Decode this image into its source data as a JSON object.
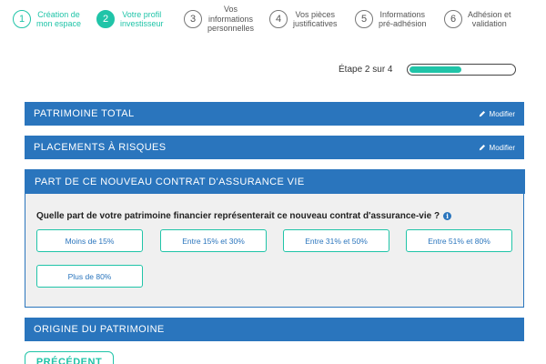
{
  "stepper": {
    "steps": [
      {
        "number": "1",
        "label": "Création de\nmon espace",
        "state": "done"
      },
      {
        "number": "2",
        "label": "Votre profil\ninvestisseur",
        "state": "active"
      },
      {
        "number": "3",
        "label": "Vos\ninformations\npersonnelles",
        "state": "todo"
      },
      {
        "number": "4",
        "label": "Vos pièces\njustificatives",
        "state": "todo"
      },
      {
        "number": "5",
        "label": "Informations\npré-adhésion",
        "state": "todo"
      },
      {
        "number": "6",
        "label": "Adhésion et\nvalidation",
        "state": "todo"
      }
    ]
  },
  "progress": {
    "text": "Étape 2 sur 4",
    "fraction": 0.5
  },
  "sections": {
    "patrimoine_total": {
      "title": "PATRIMOINE TOTAL",
      "modify_label": "Modifier"
    },
    "placements_risques": {
      "title": "PLACEMENTS À RISQUES",
      "modify_label": "Modifier"
    },
    "part_contrat": {
      "title": "PART DE CE NOUVEAU CONTRAT D'ASSURANCE VIE",
      "question": "Quelle part de votre patrimoine financier représenterait ce nouveau contrat d'assurance-vie ?",
      "options": [
        "Moins de 15%",
        "Entre 15% et 30%",
        "Entre 31% et 50%",
        "Entre 51% et 80%",
        "Plus de 80%"
      ]
    },
    "origine": {
      "title": "ORIGINE DU PATRIMOINE"
    }
  },
  "buttons": {
    "previous_label": "PRÉCÉDENT"
  },
  "colors": {
    "accent": "#20c4a8",
    "section_blue": "#2a75bd",
    "panel_bg": "#f0f0f0"
  },
  "icons": {
    "modify": "pencil-icon",
    "info": "info-icon"
  }
}
